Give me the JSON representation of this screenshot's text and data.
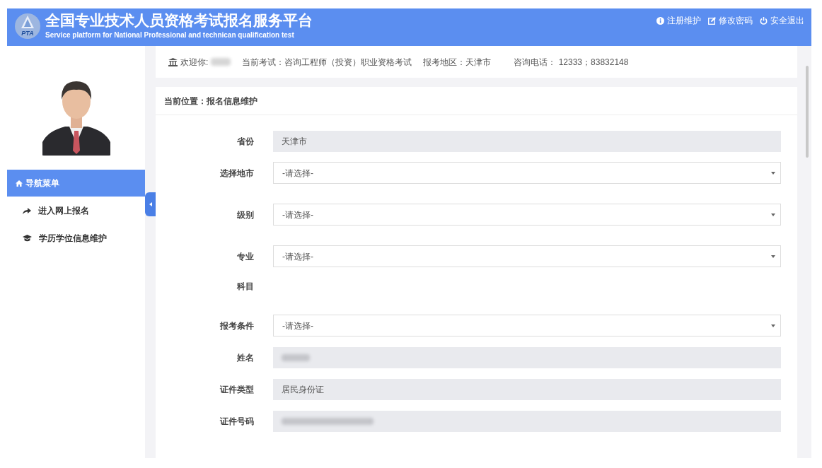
{
  "header": {
    "title": "全国专业技术人员资格考试报名服务平台",
    "subtitle": "Service platform for National Professional and technican qualification test",
    "logo_text": "PTA",
    "links": [
      {
        "kind": "info",
        "label": "注册维护"
      },
      {
        "kind": "edit",
        "label": "修改密码"
      },
      {
        "kind": "power",
        "label": "安全退出"
      }
    ]
  },
  "sidebar": {
    "items": [
      {
        "kind": "home",
        "label": "导航菜单",
        "selected": true
      },
      {
        "kind": "share",
        "label": "进入网上报名",
        "selected": false
      },
      {
        "kind": "cap",
        "label": "学历学位信息维护",
        "selected": false
      }
    ]
  },
  "info_bar": {
    "welcome": "欢迎你:",
    "welcome_redacted": true,
    "items": [
      "当前考试：咨询工程师（投资）职业资格考试",
      "报考地区：天津市",
      "咨询电话： 12333；83832148"
    ]
  },
  "breadcrumb": "当前位置：报名信息维护",
  "form": [
    {
      "label": "省份",
      "kind": "readonly",
      "value": "天津市"
    },
    {
      "label": "选择地市",
      "kind": "select",
      "value": "-请选择-"
    },
    {
      "label": "级别",
      "kind": "select",
      "value": "-请选择-"
    },
    {
      "label": "专业",
      "kind": "select",
      "value": "-请选择-"
    },
    {
      "label": "科目",
      "kind": "none"
    },
    {
      "label": "报考条件",
      "kind": "select",
      "value": "-请选择-"
    },
    {
      "label": "姓名",
      "kind": "readonly",
      "redacted": true
    },
    {
      "label": "证件类型",
      "kind": "readonly",
      "value": "居民身份证"
    },
    {
      "label": "证件号码",
      "kind": "readonly",
      "redacted": true
    }
  ]
}
